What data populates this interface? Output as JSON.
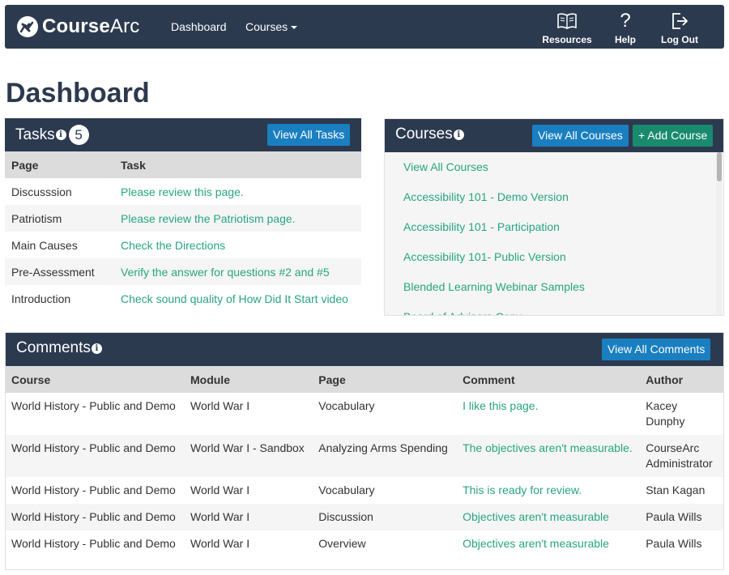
{
  "navbar": {
    "brand_bold": "Course",
    "brand_thin": "Arc",
    "links": [
      {
        "label": "Dashboard"
      },
      {
        "label": "Courses"
      }
    ],
    "right": [
      {
        "label": "Resources",
        "icon": "book-icon"
      },
      {
        "label": "Help",
        "icon": "question-icon"
      },
      {
        "label": "Log Out",
        "icon": "logout-icon"
      }
    ]
  },
  "page": {
    "title": "Dashboard"
  },
  "tasks": {
    "title": "Tasks",
    "count": "5",
    "button": "View All Tasks",
    "columns": [
      "Page",
      "Task"
    ],
    "rows": [
      {
        "page": "Discusssion",
        "task": "Please review this page."
      },
      {
        "page": "Patriotism",
        "task": "Please review the Patriotism page."
      },
      {
        "page": "Main Causes",
        "task": "Check the Directions"
      },
      {
        "page": "Pre-Assessment",
        "task": "Verify the answer for questions #2 and #5"
      },
      {
        "page": "Introduction",
        "task": "Check sound quality of How Did It Start video"
      }
    ]
  },
  "courses": {
    "title": "Courses",
    "button_view": "View All Courses",
    "button_add": "+ Add Course",
    "items": [
      "View All Courses",
      "Accessibility 101 - Demo Version",
      "Accessibility 101 - Participation",
      "Accessibility 101- Public Version",
      "Blended Learning Webinar Samples",
      "Board of Advisors Copy"
    ]
  },
  "comments": {
    "title": "Comments",
    "button": "View All Comments",
    "columns": [
      "Course",
      "Module",
      "Page",
      "Comment",
      "Author"
    ],
    "rows": [
      {
        "course": "World History - Public and Demo",
        "module": "World War I",
        "page": "Vocabulary",
        "comment": "I like this page.",
        "author": "Kacey Dunphy"
      },
      {
        "course": "World History - Public and Demo",
        "module": "World War I - Sandbox",
        "page": "Analyzing Arms Spending",
        "comment": "The objectives aren't measurable.",
        "author": "CourseArc Administrator"
      },
      {
        "course": "World History - Public and Demo",
        "module": "World War I",
        "page": "Vocabulary",
        "comment": "This is ready for review.",
        "author": "Stan Kagan"
      },
      {
        "course": "World History - Public and Demo",
        "module": "World War I",
        "page": "Discussion",
        "comment": "Objectives aren't measurable",
        "author": "Paula Wills"
      },
      {
        "course": "World History - Public and Demo",
        "module": "World War I",
        "page": "Overview",
        "comment": "Objectives aren't measurable",
        "author": "Paula Wills"
      }
    ]
  },
  "colors": {
    "navy": "#2c3a4f",
    "button_blue": "#1a7fc1",
    "button_green": "#198a6e",
    "link_green": "#27a57f"
  }
}
